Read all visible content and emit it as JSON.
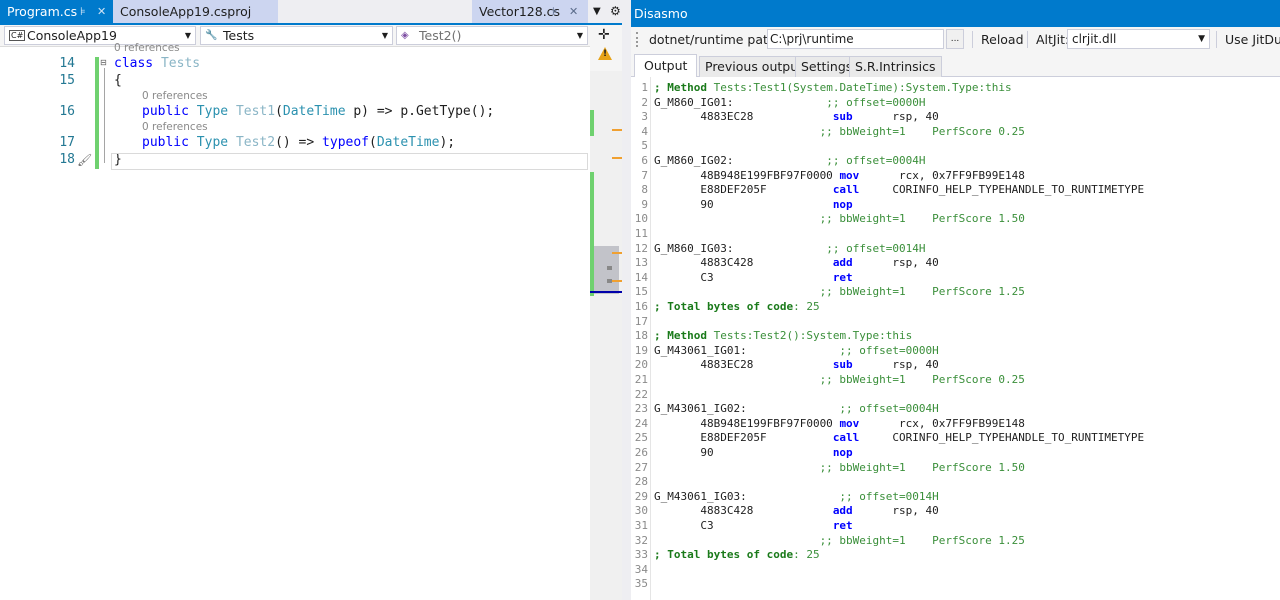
{
  "editor": {
    "tabs": [
      {
        "label": "Program.cs"
      },
      {
        "label": "ConsoleApp19.csproj"
      },
      {
        "label": "Vector128.cs"
      }
    ],
    "nav": {
      "project": "ConsoleApp19",
      "class": "Tests",
      "member": "Test2()"
    },
    "code": {
      "lens_top": "0 references",
      "line14": {
        "num": "14",
        "kw": "class",
        "name": "Tests"
      },
      "line15": {
        "num": "15",
        "text": "{"
      },
      "lens16": "0 references",
      "line16": {
        "num": "16",
        "kw": "public",
        "type": "Type",
        "name": "Test1",
        "open": "(",
        "ptype": "DateTime",
        "rest": " p) => p.GetType();"
      },
      "lens17": "0 references",
      "line17": {
        "num": "17",
        "kw": "public",
        "type": "Type",
        "name": "Test2",
        "mid": "() => ",
        "kw2": "typeof",
        "open": "(",
        "ptype": "DateTime",
        "close": ");"
      },
      "line18": {
        "num": "18",
        "text": "}"
      }
    },
    "icons": {
      "split": "split-view-icon",
      "warning": "warning-icon",
      "brush": "quick-action-brush-icon"
    }
  },
  "tool": {
    "title": "Disasmo",
    "runtime_label": "dotnet/runtime path:",
    "runtime_value": "C:\\prj\\runtime",
    "browse_label": "...",
    "reload_label": "Reload",
    "altjit_label": "AltJit:",
    "altjit_value": "clrjit.dll",
    "use_jitdump_label": "Use JitDum",
    "tabs": [
      {
        "label": "Output"
      },
      {
        "label": "Previous output"
      },
      {
        "label": "Settings"
      },
      {
        "label": "S.R.Intrinsics"
      }
    ]
  },
  "asm": [
    {
      "n": "1",
      "segs": [
        {
          "c": "cmb",
          "t": "; Method "
        },
        {
          "c": "cm",
          "t": "Tests:Test1(System.DateTime):System.Type:this"
        }
      ]
    },
    {
      "n": "2",
      "segs": [
        {
          "c": "",
          "t": "G_M860_IG01:"
        },
        {
          "c": "cm",
          "t": "              ;; offset=0000H"
        }
      ]
    },
    {
      "n": "3",
      "segs": [
        {
          "c": "",
          "t": "       4883EC28            "
        },
        {
          "c": "op",
          "t": "sub"
        },
        {
          "c": "",
          "t": "      rsp, 40"
        }
      ]
    },
    {
      "n": "4",
      "segs": [
        {
          "c": "cm",
          "t": "                         ;; bbWeight=1    PerfScore 0.25"
        }
      ]
    },
    {
      "n": "5",
      "segs": []
    },
    {
      "n": "6",
      "segs": [
        {
          "c": "",
          "t": "G_M860_IG02:"
        },
        {
          "c": "cm",
          "t": "              ;; offset=0004H"
        }
      ]
    },
    {
      "n": "7",
      "segs": [
        {
          "c": "",
          "t": "       48B948E199FBF97F0000 "
        },
        {
          "c": "op",
          "t": "mov"
        },
        {
          "c": "",
          "t": "      rcx, 0x7FF9FB99E148"
        }
      ]
    },
    {
      "n": "8",
      "segs": [
        {
          "c": "",
          "t": "       E88DEF205F          "
        },
        {
          "c": "op",
          "t": "call"
        },
        {
          "c": "",
          "t": "     CORINFO_HELP_TYPEHANDLE_TO_RUNTIMETYPE"
        }
      ]
    },
    {
      "n": "9",
      "segs": [
        {
          "c": "",
          "t": "       90                  "
        },
        {
          "c": "op",
          "t": "nop"
        }
      ]
    },
    {
      "n": "10",
      "segs": [
        {
          "c": "cm",
          "t": "                         ;; bbWeight=1    PerfScore 1.50"
        }
      ]
    },
    {
      "n": "11",
      "segs": []
    },
    {
      "n": "12",
      "segs": [
        {
          "c": "",
          "t": "G_M860_IG03:"
        },
        {
          "c": "cm",
          "t": "              ;; offset=0014H"
        }
      ]
    },
    {
      "n": "13",
      "segs": [
        {
          "c": "",
          "t": "       4883C428            "
        },
        {
          "c": "op",
          "t": "add"
        },
        {
          "c": "",
          "t": "      rsp, 40"
        }
      ]
    },
    {
      "n": "14",
      "segs": [
        {
          "c": "",
          "t": "       C3                  "
        },
        {
          "c": "op",
          "t": "ret"
        }
      ]
    },
    {
      "n": "15",
      "segs": [
        {
          "c": "cm",
          "t": "                         ;; bbWeight=1    PerfScore 1.25"
        }
      ]
    },
    {
      "n": "16",
      "segs": [
        {
          "c": "cmb",
          "t": "; Total bytes of code"
        },
        {
          "c": "cm",
          "t": ": 25"
        }
      ]
    },
    {
      "n": "17",
      "segs": []
    },
    {
      "n": "18",
      "segs": [
        {
          "c": "cmb",
          "t": "; Method "
        },
        {
          "c": "cm",
          "t": "Tests:Test2():System.Type:this"
        }
      ]
    },
    {
      "n": "19",
      "segs": [
        {
          "c": "",
          "t": "G_M43061_IG01:"
        },
        {
          "c": "cm",
          "t": "              ;; offset=0000H"
        }
      ]
    },
    {
      "n": "20",
      "segs": [
        {
          "c": "",
          "t": "       4883EC28            "
        },
        {
          "c": "op",
          "t": "sub"
        },
        {
          "c": "",
          "t": "      rsp, 40"
        }
      ]
    },
    {
      "n": "21",
      "segs": [
        {
          "c": "cm",
          "t": "                         ;; bbWeight=1    PerfScore 0.25"
        }
      ]
    },
    {
      "n": "22",
      "segs": []
    },
    {
      "n": "23",
      "segs": [
        {
          "c": "",
          "t": "G_M43061_IG02:"
        },
        {
          "c": "cm",
          "t": "              ;; offset=0004H"
        }
      ]
    },
    {
      "n": "24",
      "segs": [
        {
          "c": "",
          "t": "       48B948E199FBF97F0000 "
        },
        {
          "c": "op",
          "t": "mov"
        },
        {
          "c": "",
          "t": "      rcx, 0x7FF9FB99E148"
        }
      ]
    },
    {
      "n": "25",
      "segs": [
        {
          "c": "",
          "t": "       E88DEF205F          "
        },
        {
          "c": "op",
          "t": "call"
        },
        {
          "c": "",
          "t": "     CORINFO_HELP_TYPEHANDLE_TO_RUNTIMETYPE"
        }
      ]
    },
    {
      "n": "26",
      "segs": [
        {
          "c": "",
          "t": "       90                  "
        },
        {
          "c": "op",
          "t": "nop"
        }
      ]
    },
    {
      "n": "27",
      "segs": [
        {
          "c": "cm",
          "t": "                         ;; bbWeight=1    PerfScore 1.50"
        }
      ]
    },
    {
      "n": "28",
      "segs": []
    },
    {
      "n": "29",
      "segs": [
        {
          "c": "",
          "t": "G_M43061_IG03:"
        },
        {
          "c": "cm",
          "t": "              ;; offset=0014H"
        }
      ]
    },
    {
      "n": "30",
      "segs": [
        {
          "c": "",
          "t": "       4883C428            "
        },
        {
          "c": "op",
          "t": "add"
        },
        {
          "c": "",
          "t": "      rsp, 40"
        }
      ]
    },
    {
      "n": "31",
      "segs": [
        {
          "c": "",
          "t": "       C3                  "
        },
        {
          "c": "op",
          "t": "ret"
        }
      ]
    },
    {
      "n": "32",
      "segs": [
        {
          "c": "cm",
          "t": "                         ;; bbWeight=1    PerfScore 1.25"
        }
      ]
    },
    {
      "n": "33",
      "segs": [
        {
          "c": "cmb",
          "t": "; Total bytes of code"
        },
        {
          "c": "cm",
          "t": ": 25"
        }
      ]
    },
    {
      "n": "34",
      "segs": []
    },
    {
      "n": "35",
      "segs": []
    }
  ]
}
